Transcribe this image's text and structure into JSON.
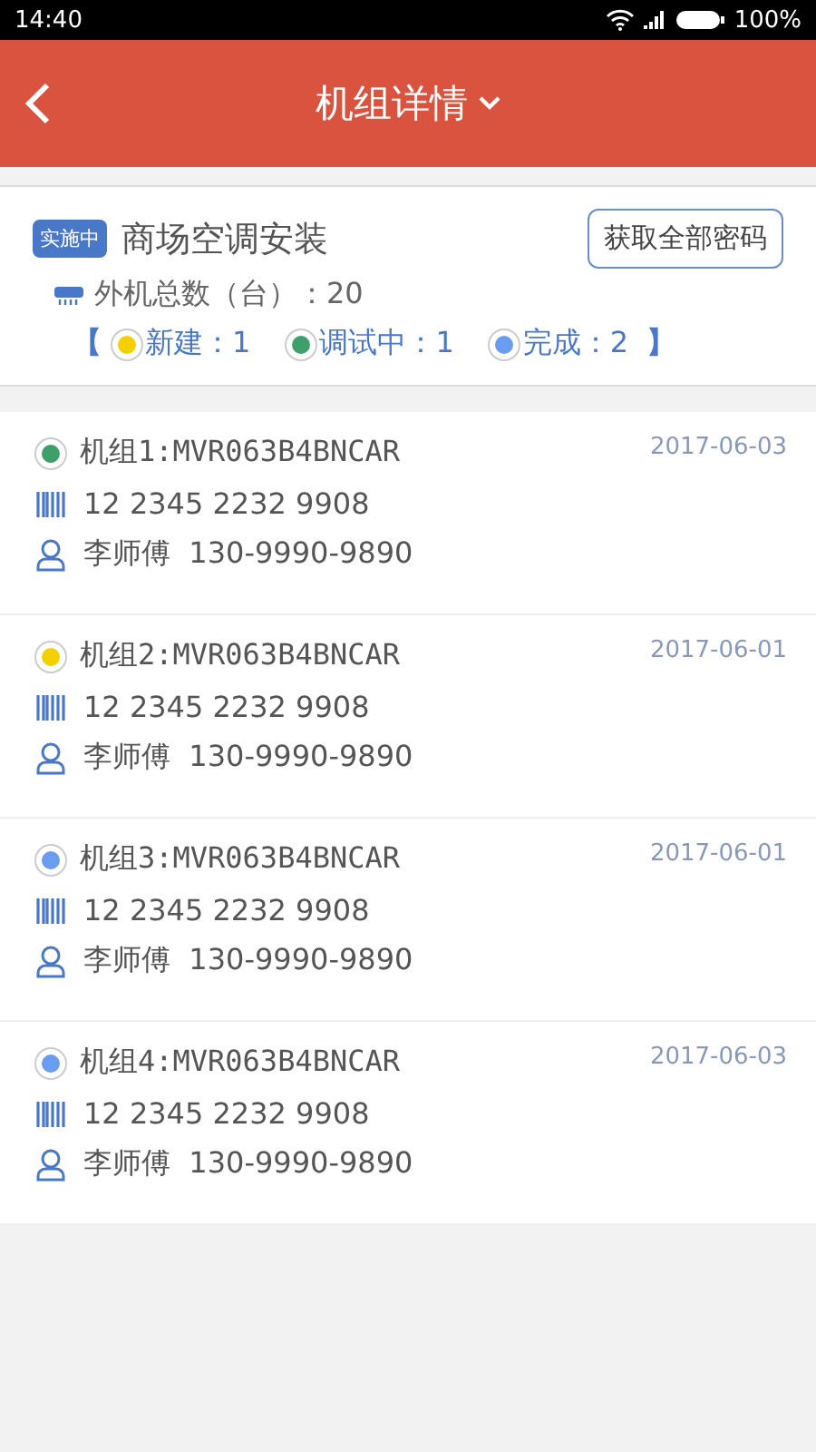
{
  "status_bar": {
    "time": "14:40",
    "battery": "100%"
  },
  "header": {
    "title": "机组详情"
  },
  "project": {
    "badge": "实施中",
    "name": "商场空调安装",
    "button": "获取全部密码",
    "total": "外机总数（台）：20",
    "open_bracket": "【",
    "close_bracket": "】",
    "counts": [
      {
        "label": "新建：1",
        "color": "#f5d000"
      },
      {
        "label": "调试中：1",
        "color": "#3f9f6a"
      },
      {
        "label": "完成：2",
        "color": "#6a9cf0"
      }
    ]
  },
  "units": [
    {
      "name": "机组1:MVR063B4BNCAR",
      "date": "2017-06-03",
      "code": "12 2345 2232 9908",
      "contact": "李师傅  130-9990-9890",
      "color": "#3f9f6a"
    },
    {
      "name": "机组2:MVR063B4BNCAR",
      "date": "2017-06-01",
      "code": "12 2345 2232 9908",
      "contact": "李师傅  130-9990-9890",
      "color": "#f5d000"
    },
    {
      "name": "机组3:MVR063B4BNCAR",
      "date": "2017-06-01",
      "code": "12 2345 2232 9908",
      "contact": "李师傅  130-9990-9890",
      "color": "#6a9cf0"
    },
    {
      "name": "机组4:MVR063B4BNCAR",
      "date": "2017-06-03",
      "code": "12 2345 2232 9908",
      "contact": "李师傅  130-9990-9890",
      "color": "#6a9cf0"
    }
  ]
}
